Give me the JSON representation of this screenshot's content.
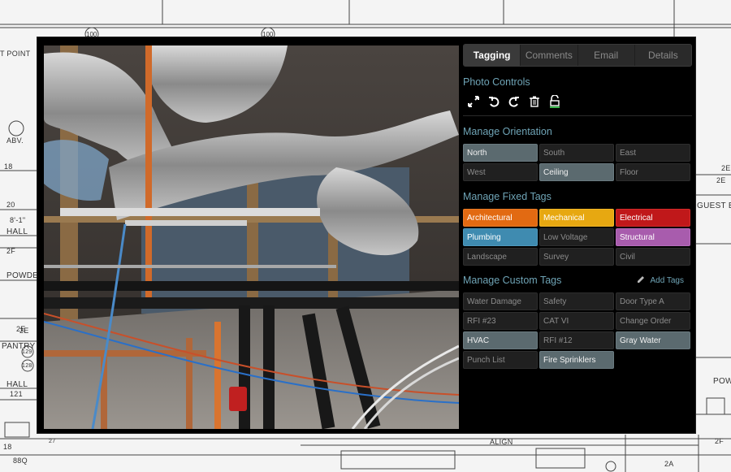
{
  "blueprint": {
    "labels": [
      "100",
      "100",
      "T POINT",
      "ABV.",
      "18",
      "20",
      "8'-1\"",
      "HALL",
      "POWDE",
      "2E",
      "PANTRY",
      "129",
      "128",
      "HALL",
      "121",
      "18",
      "27",
      "88Q",
      "ALIGN",
      "2A",
      "2E",
      "GUEST B",
      "POW",
      "2F",
      "2F",
      "2E",
      "2E"
    ]
  },
  "tabs": [
    {
      "label": "Tagging",
      "active": true
    },
    {
      "label": "Comments",
      "active": false
    },
    {
      "label": "Email",
      "active": false
    },
    {
      "label": "Details",
      "active": false
    }
  ],
  "photo_controls": {
    "title": "Photo Controls",
    "icons": [
      "fullscreen-icon",
      "rotate-left-icon",
      "rotate-right-icon",
      "trash-icon",
      "unlock-icon"
    ]
  },
  "orientation": {
    "title": "Manage Orientation",
    "items": [
      {
        "label": "North",
        "selected": true
      },
      {
        "label": "South",
        "selected": false
      },
      {
        "label": "East",
        "selected": false
      },
      {
        "label": "West",
        "selected": false
      },
      {
        "label": "Ceiling",
        "selected": true
      },
      {
        "label": "Floor",
        "selected": false
      }
    ]
  },
  "fixed_tags": {
    "title": "Manage Fixed Tags",
    "items": [
      {
        "label": "Architectural",
        "color": "#e26a12"
      },
      {
        "label": "Mechanical",
        "color": "#e7a811"
      },
      {
        "label": "Electrical",
        "color": "#c0181a"
      },
      {
        "label": "Plumbing",
        "color": "#3f8bb0"
      },
      {
        "label": "Low Voltage",
        "color": ""
      },
      {
        "label": "Structural",
        "color": "#a85cad"
      },
      {
        "label": "Landscape",
        "color": ""
      },
      {
        "label": "Survey",
        "color": ""
      },
      {
        "label": "Civil",
        "color": ""
      }
    ]
  },
  "custom_tags": {
    "title": "Manage Custom Tags",
    "add_label": "Add Tags",
    "items": [
      {
        "label": "Water Damage",
        "selected": false
      },
      {
        "label": "Safety",
        "selected": false
      },
      {
        "label": "Door Type A",
        "selected": false
      },
      {
        "label": "RFI #23",
        "selected": false
      },
      {
        "label": "CAT VI",
        "selected": false
      },
      {
        "label": "Change Order",
        "selected": false
      },
      {
        "label": "HVAC",
        "selected": true
      },
      {
        "label": "RFI #12",
        "selected": false
      },
      {
        "label": "Gray Water",
        "selected": true
      },
      {
        "label": "Punch List",
        "selected": false
      },
      {
        "label": "Fire Sprinklers",
        "selected": true
      }
    ]
  },
  "colors": {
    "accent": "#6fa4b6",
    "selected_chip": "#5b6a6f"
  }
}
